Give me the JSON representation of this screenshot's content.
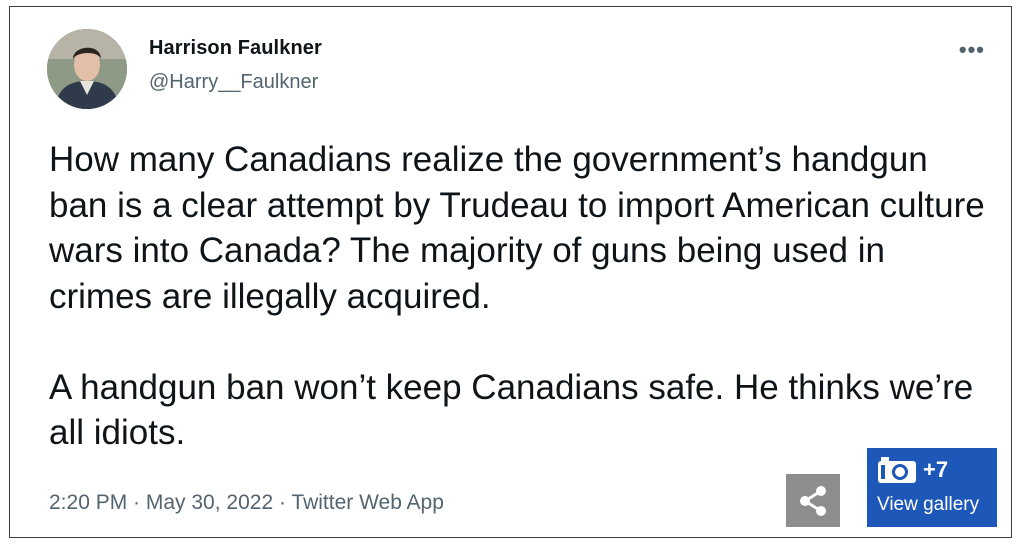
{
  "tweet": {
    "author_name": "Harrison Faulkner",
    "author_handle": "@Harry__Faulkner",
    "more_icon": "•••",
    "text": "How many Canadians realize the government’s handgun ban is a clear attempt by Trudeau to import American culture wars into Canada? The majority of guns being used in crimes are illegally acquired.\n\nA handgun ban won’t keep Canadians safe. He thinks we’re all idiots.",
    "timestamp": "2:20 PM · May 30, 2022 · Twitter Web App"
  },
  "gallery": {
    "count": "+7",
    "label": "View gallery",
    "icon": "camera-icon"
  },
  "share": {
    "icon": "share-icon"
  },
  "colors": {
    "gallery_bg": "#1d57b8",
    "share_bg": "#8d8d8d"
  }
}
